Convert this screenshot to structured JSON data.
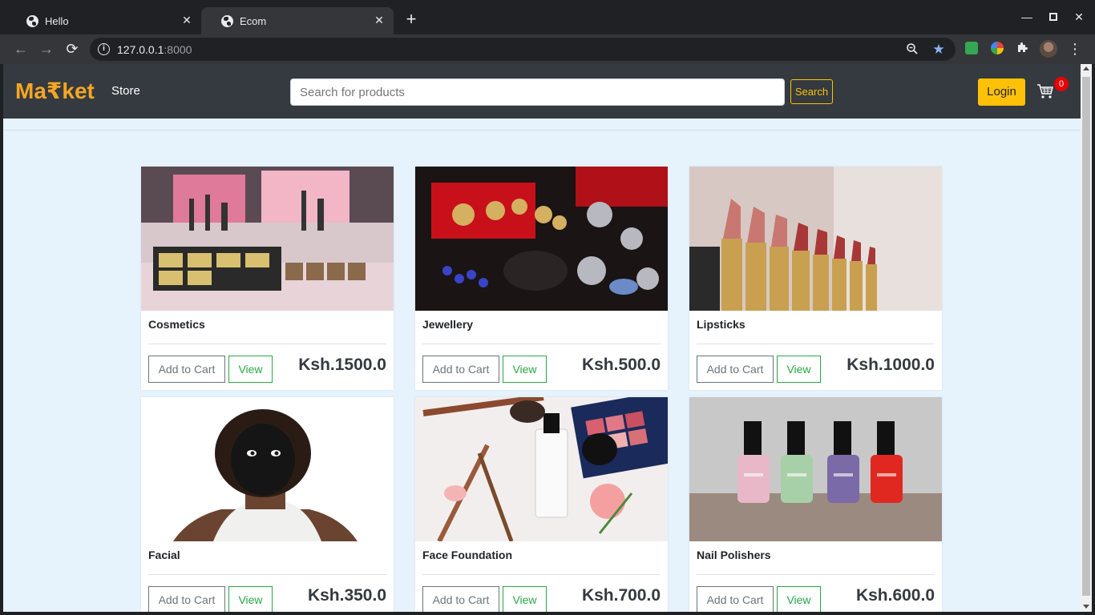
{
  "browser": {
    "tabs": [
      {
        "title": "Hello",
        "active": false
      },
      {
        "title": "Ecom",
        "active": true
      }
    ],
    "url_host": "127.0.0.1",
    "url_port": ":8000"
  },
  "navbar": {
    "brand": "Ma₹ket",
    "store_link": "Store",
    "search_placeholder": "Search for products",
    "search_button": "Search",
    "login_button": "Login",
    "cart_count": "0"
  },
  "products": [
    {
      "name": "Cosmetics",
      "add_label": "Add to Cart",
      "view_label": "View",
      "price": "Ksh.1500.0",
      "image": "cosmetics-photo"
    },
    {
      "name": "Jewellery",
      "add_label": "Add to Cart",
      "view_label": "View",
      "price": "Ksh.500.0",
      "image": "jewellery-photo"
    },
    {
      "name": "Lipsticks",
      "add_label": "Add to Cart",
      "view_label": "View",
      "price": "Ksh.1000.0",
      "image": "lipsticks-photo"
    },
    {
      "name": "Facial",
      "add_label": "Add to Cart",
      "view_label": "View",
      "price": "Ksh.350.0",
      "image": "facial-photo"
    },
    {
      "name": "Face Foundation",
      "add_label": "Add to Cart",
      "view_label": "View",
      "price": "Ksh.700.0",
      "image": "face-foundation-photo"
    },
    {
      "name": "Nail Polishers",
      "add_label": "Add to Cart",
      "view_label": "View",
      "price": "Ksh.600.0",
      "image": "nail-polishers-photo"
    }
  ],
  "colors": {
    "brand": "#f5a623",
    "navbar_bg": "#343a40",
    "page_bg": "#e6f3fd",
    "accent_yellow": "#ffc107",
    "view_green": "#28a745",
    "badge_red": "#e80000"
  }
}
